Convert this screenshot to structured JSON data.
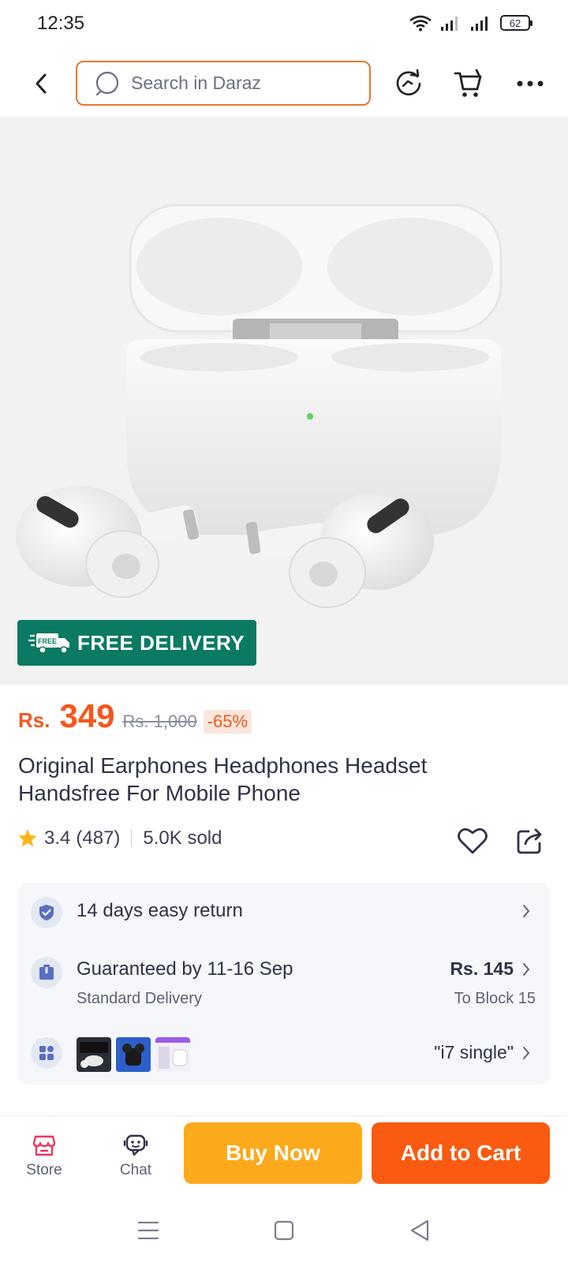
{
  "status_bar": {
    "time": "12:35",
    "battery": "62"
  },
  "top_nav": {
    "search_placeholder": "Search in Daraz"
  },
  "hero": {
    "badge_label": "FREE DELIVERY",
    "badge_icon_text": "FREE"
  },
  "price": {
    "currency": "Rs.",
    "value": "349",
    "original": "Rs. 1,000",
    "discount": "-65%"
  },
  "product": {
    "title": "Original Earphones Headphones Headset Handsfree For Mobile Phone",
    "rating": "3.4",
    "reviews": "(487)",
    "sold": "5.0K sold"
  },
  "info": {
    "return_label": "14 days easy return",
    "delivery_label": "Guaranteed by 11-16 Sep",
    "delivery_sub": "Standard Delivery",
    "delivery_price": "Rs. 145",
    "delivery_to": "To Block 15",
    "variant_label": "\"i7  single\""
  },
  "bottom_bar": {
    "store_label": "Store",
    "chat_label": "Chat",
    "buy_now_label": "Buy Now",
    "add_to_cart_label": "Add to Cart"
  },
  "colors": {
    "accent_orange": "#f5571c",
    "buy_now": "#fca91c",
    "add_to_cart": "#fa5b10",
    "free_badge": "#0a7a63",
    "search_border": "#e8772e"
  }
}
